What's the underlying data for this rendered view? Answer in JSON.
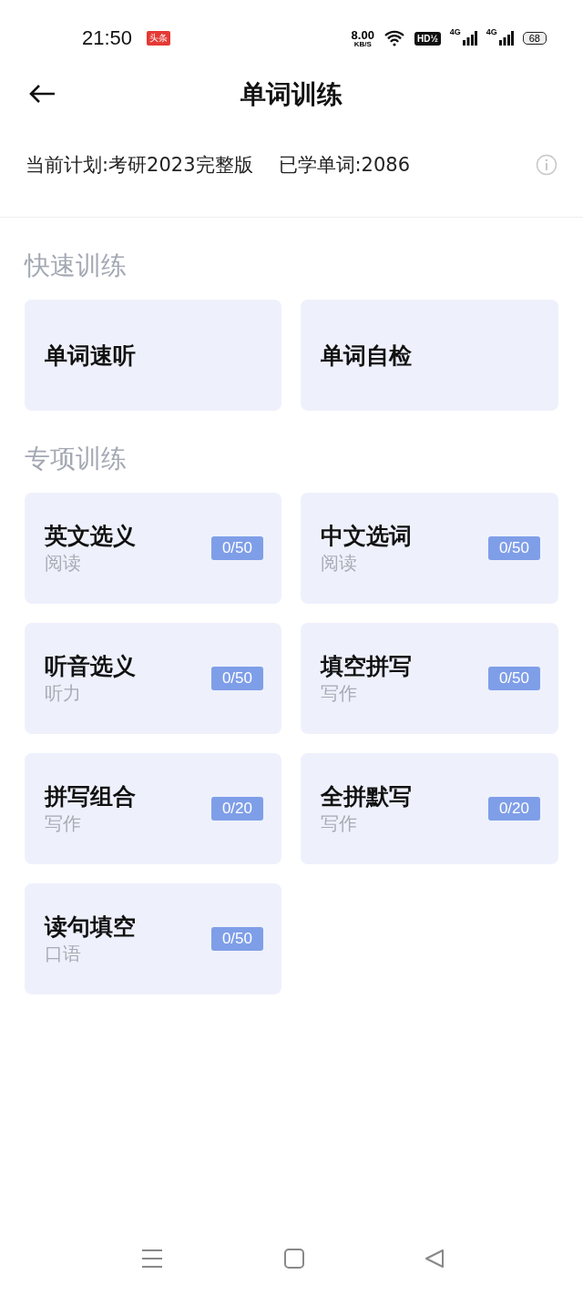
{
  "status_bar": {
    "time": "21:50",
    "app_badge": "头条",
    "speed": "8.00",
    "speed_unit": "KB/S",
    "hd": "HD",
    "hd_mark": "½",
    "network_1": "4G",
    "network_2": "4G",
    "battery": "68"
  },
  "header": {
    "title": "单词训练"
  },
  "plan": {
    "current": "当前计划:考研2023完整版",
    "learned": "已学单词:2086"
  },
  "sections": [
    {
      "title": "快速训练",
      "cards": [
        {
          "title": "单词速听"
        },
        {
          "title": "单词自检"
        }
      ]
    },
    {
      "title": "专项训练",
      "cards": [
        {
          "title": "英文选义",
          "subtitle": "阅读",
          "progress": "0/50"
        },
        {
          "title": "中文选词",
          "subtitle": "阅读",
          "progress": "0/50"
        },
        {
          "title": "听音选义",
          "subtitle": "听力",
          "progress": "0/50"
        },
        {
          "title": "填空拼写",
          "subtitle": "写作",
          "progress": "0/50"
        },
        {
          "title": "拼写组合",
          "subtitle": "写作",
          "progress": "0/20"
        },
        {
          "title": "全拼默写",
          "subtitle": "写作",
          "progress": "0/20"
        },
        {
          "title": "读句填空",
          "subtitle": "口语",
          "progress": "0/50"
        }
      ]
    }
  ]
}
